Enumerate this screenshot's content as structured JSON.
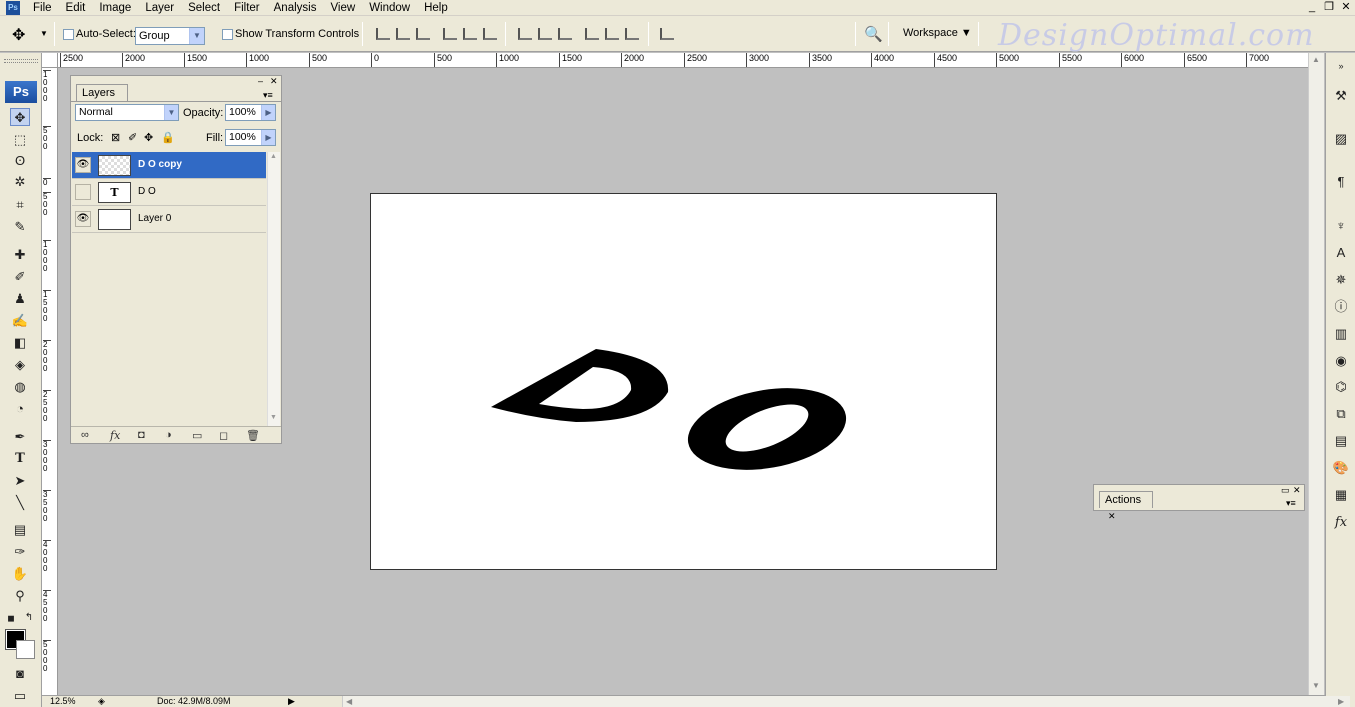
{
  "menu": {
    "items": [
      "File",
      "Edit",
      "Image",
      "Layer",
      "Select",
      "Filter",
      "Analysis",
      "View",
      "Window",
      "Help"
    ]
  },
  "window_controls": {
    "minimize": "_",
    "restore": "❐",
    "close": "✕"
  },
  "options_bar": {
    "auto_select_label": "Auto-Select:",
    "auto_select_value": "Group",
    "show_transform_label": "Show Transform Controls",
    "workspace_label": "Workspace ▼"
  },
  "watermark": "DesignOptimal.com",
  "toolbox": {
    "badge": "Ps"
  },
  "rulers": {
    "top": [
      "2500",
      "2000",
      "1500",
      "1000",
      "500",
      "0",
      "500",
      "1000",
      "1500",
      "2000",
      "2500",
      "3000",
      "3500",
      "4000",
      "4500",
      "5000",
      "5500",
      "6000",
      "6500",
      "7000"
    ],
    "left": [
      "1000",
      "500",
      "0",
      "500",
      "1000",
      "1500",
      "2000",
      "2500",
      "3000",
      "3500",
      "4000",
      "4500",
      "5000",
      "5500"
    ]
  },
  "layers_panel": {
    "tab_label": "Layers",
    "tab_close": "✕",
    "blend_mode": "Normal",
    "opacity_label": "Opacity:",
    "opacity_value": "100%",
    "lock_label": "Lock:",
    "fill_label": "Fill:",
    "fill_value": "100%",
    "layers": [
      {
        "name": "D O copy",
        "visible": true,
        "selected": true,
        "thumb": ""
      },
      {
        "name": "D O",
        "visible": false,
        "selected": false,
        "thumb": "T"
      },
      {
        "name": "Layer 0",
        "visible": true,
        "selected": false,
        "thumb": ""
      }
    ]
  },
  "actions_panel": {
    "tab_label": "Actions",
    "tab_close": "✕"
  },
  "canvas": {
    "text_1": "D",
    "text_2": "O"
  },
  "status_bar": {
    "zoom": "12.5%",
    "doc": "Doc: 42.9M/8.09M"
  }
}
